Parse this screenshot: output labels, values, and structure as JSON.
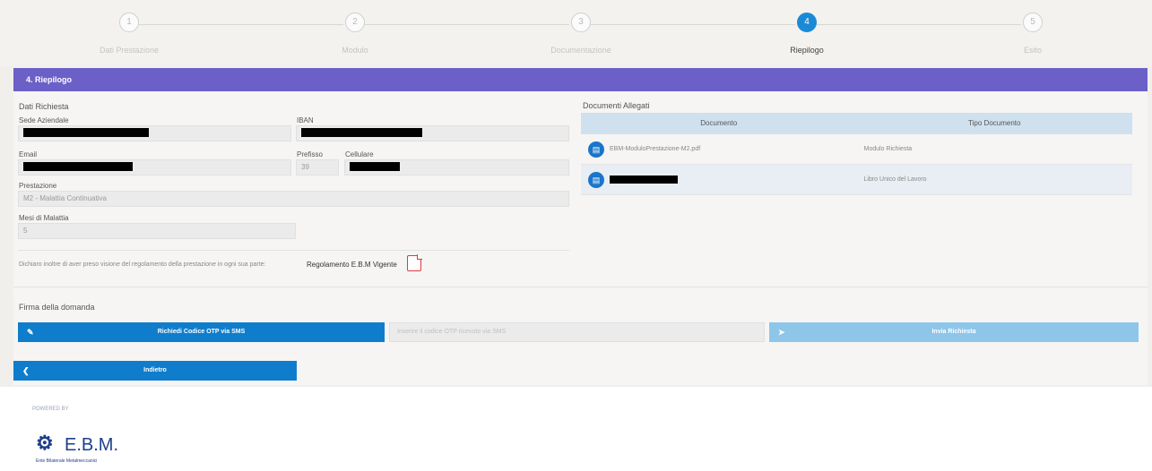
{
  "steps": [
    {
      "number": "1",
      "label": "Dati Prestazione"
    },
    {
      "number": "2",
      "label": "Modulo"
    },
    {
      "number": "3",
      "label": "Documentazione"
    },
    {
      "number": "4",
      "label": "Riepilogo"
    },
    {
      "number": "5",
      "label": "Esito"
    }
  ],
  "active_step": 4,
  "panel": {
    "title": "4. Riepilogo"
  },
  "dati": {
    "section_title": "Dati Richiesta",
    "sede_label": "Sede Aziendale",
    "iban_label": "IBAN",
    "email_label": "Email",
    "prefisso_label": "Prefisso",
    "prefisso_value": "39",
    "cellulare_label": "Cellulare",
    "prestazione_label": "Prestazione",
    "prestazione_value": "M2 - Malattia Continuativa",
    "mesi_label": "Mesi di Malattia",
    "mesi_value": "5",
    "declaration_text": "Dichiaro inoltre di aver preso visione del regolamento della prestazione in ogni sua parte:",
    "regolamento_link": "Regolamento E.B.M Vigente"
  },
  "documenti": {
    "section_title": "Documenti Allegati",
    "headers": [
      "Documento",
      "Tipo Documento"
    ],
    "rows": [
      {
        "name": "EBM-ModuloPrestazione-M2.pdf",
        "type": "Modulo Richiesta"
      },
      {
        "name": "",
        "type": "Libro Unico del Lavoro"
      }
    ]
  },
  "firma": {
    "section_title": "Firma della domanda",
    "send_otp_button": "Richiedi Codice OTP via SMS",
    "otp_placeholder": "Inserire il codice OTP ricevuto via SMS",
    "send_request_button": "Invia Richiesta"
  },
  "back_button": "Indietro",
  "footer": {
    "powered_by": "POWERED BY",
    "logo_text": "E.B.M.",
    "logo_sub": "Ente Bilaterale Metalmeccanici"
  },
  "colors": {
    "accent": "#1a8ad6",
    "header": "#6a60c7",
    "primary_button": "#0f7dcc",
    "disabled_button": "#8ec6ea"
  }
}
